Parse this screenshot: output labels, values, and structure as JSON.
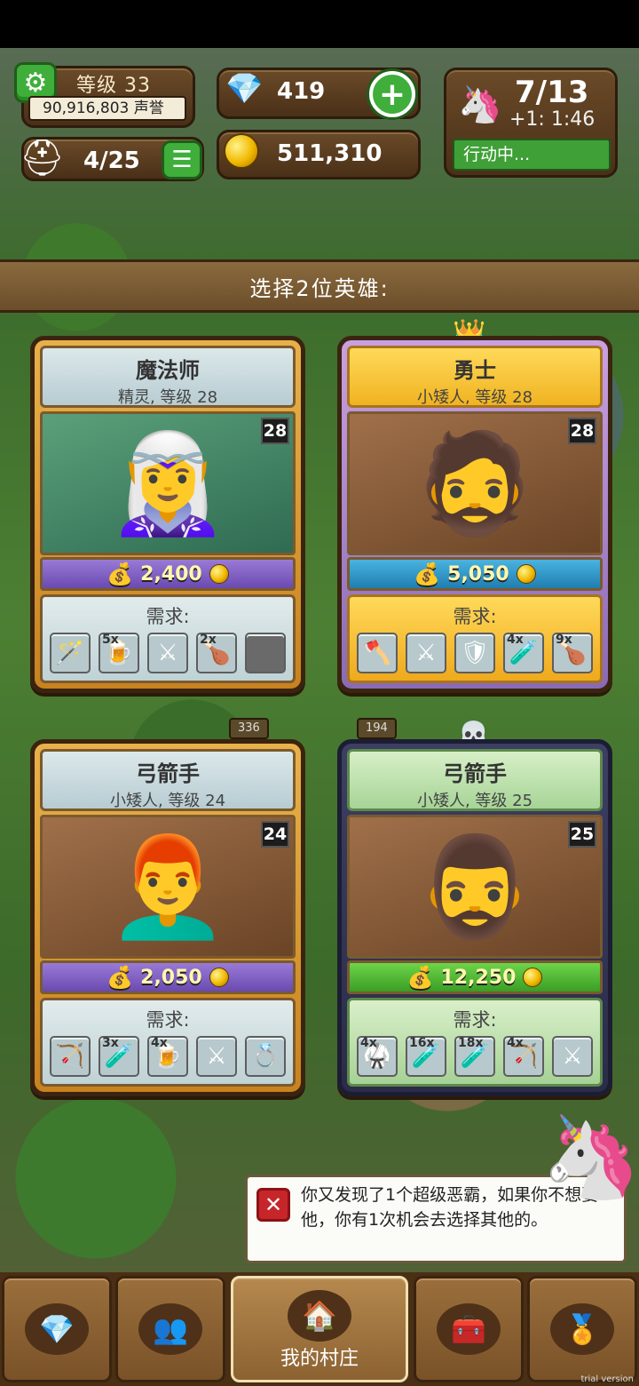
{
  "hud": {
    "level": "等级 33",
    "reputation": "90,916,803 声誉",
    "heroes": "4/25",
    "gems": "419",
    "gold": "511,310",
    "energy": "7/13",
    "energy_timer": "+1: 1:46",
    "action_status": "行动中..."
  },
  "banner": "选择2位英雄:",
  "cards": [
    {
      "cls": "魔法师",
      "sub": "精灵, 等级 28",
      "level": "28",
      "price": "2,400",
      "needs_label": "需求:",
      "slots": [
        {
          "icon": "wand-icon",
          "glyph": "🪄",
          "qty": ""
        },
        {
          "icon": "ale-icon",
          "glyph": "🍺",
          "qty": "5x"
        },
        {
          "icon": "swords-icon",
          "glyph": "⚔",
          "qty": ""
        },
        {
          "icon": "meat-icon",
          "glyph": "🍗",
          "qty": "2x"
        },
        {
          "icon": "empty-slot-icon",
          "glyph": "",
          "qty": ""
        }
      ]
    },
    {
      "cls": "勇士",
      "sub": "小矮人, 等级 28",
      "level": "28",
      "price": "5,050",
      "needs_label": "需求:",
      "slots": [
        {
          "icon": "axe-icon",
          "glyph": "🪓",
          "qty": ""
        },
        {
          "icon": "swords-icon",
          "glyph": "⚔",
          "qty": ""
        },
        {
          "icon": "armor-icon",
          "glyph": "🛡",
          "qty": ""
        },
        {
          "icon": "green-potion-icon",
          "glyph": "🧪",
          "qty": "4x"
        },
        {
          "icon": "meat-icon",
          "glyph": "🍗",
          "qty": "9x"
        }
      ]
    },
    {
      "cls": "弓箭手",
      "sub": "小矮人, 等级 24",
      "level": "24",
      "price": "2,050",
      "needs_label": "需求:",
      "slots": [
        {
          "icon": "crossbow-icon",
          "glyph": "🏹",
          "qty": ""
        },
        {
          "icon": "green-potion-icon",
          "glyph": "🧪",
          "qty": "3x"
        },
        {
          "icon": "ale-icon",
          "glyph": "🍺",
          "qty": "4x"
        },
        {
          "icon": "swords-icon",
          "glyph": "⚔",
          "qty": ""
        },
        {
          "icon": "ring-icon",
          "glyph": "💍",
          "qty": ""
        }
      ]
    },
    {
      "cls": "弓箭手",
      "sub": "小矮人, 等级 25",
      "level": "25",
      "price": "12,250",
      "needs_label": "需求:",
      "slots": [
        {
          "icon": "armor-icon",
          "glyph": "🥋",
          "qty": "4x"
        },
        {
          "icon": "red-potion-icon",
          "glyph": "🧪",
          "qty": "16x"
        },
        {
          "icon": "green-potion-icon",
          "glyph": "🧪",
          "qty": "18x"
        },
        {
          "icon": "crossbow-icon",
          "glyph": "🏹",
          "qty": "4x"
        },
        {
          "icon": "swords-icon",
          "glyph": "⚔",
          "qty": ""
        }
      ]
    }
  ],
  "map_badges": [
    "336",
    "194"
  ],
  "message": "你又发现了1个超级恶霸，如果你不想要他，你有1次机会去选择其他的。",
  "nav": {
    "village_label": "我的村庄"
  },
  "watermark": "trial version"
}
